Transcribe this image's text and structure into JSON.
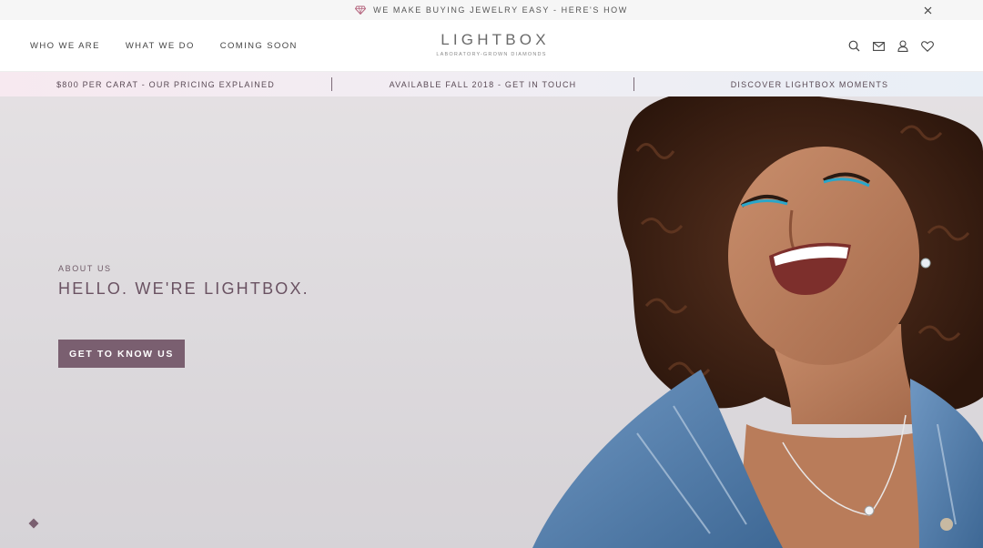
{
  "announcement": {
    "text": "WE MAKE BUYING JEWELRY EASY - HERE'S HOW",
    "icon": "diamond-icon",
    "close_icon": "close-icon"
  },
  "header": {
    "nav_left": [
      "WHO WE ARE",
      "WHAT WE DO",
      "COMING SOON"
    ],
    "logo": {
      "word": "LIGHTBOX",
      "tagline": "LABORATORY-GROWN DIAMONDS"
    },
    "nav_right_icons": [
      "search-icon",
      "mail-icon",
      "account-icon",
      "wishlist-heart-icon"
    ]
  },
  "promo_strip": {
    "items": [
      "$800 PER CARAT - OUR PRICING EXPLAINED",
      "AVAILABLE FALL 2018 - GET IN TOUCH",
      "DISCOVER LIGHTBOX MOMENTS"
    ]
  },
  "hero": {
    "eyebrow": "ABOUT US",
    "headline": "HELLO. WE'RE LIGHTBOX.",
    "cta_label": "GET TO KNOW US",
    "slide_indicator_icon": "diamond-dot-icon"
  },
  "colors": {
    "brand_mauve": "#7a5f70",
    "headline": "#6a5262",
    "announce_bg": "#f6f6f6",
    "promo_left": "#f7e9f0",
    "promo_right": "#e9eff6",
    "hero_bg": "#dddadd"
  }
}
